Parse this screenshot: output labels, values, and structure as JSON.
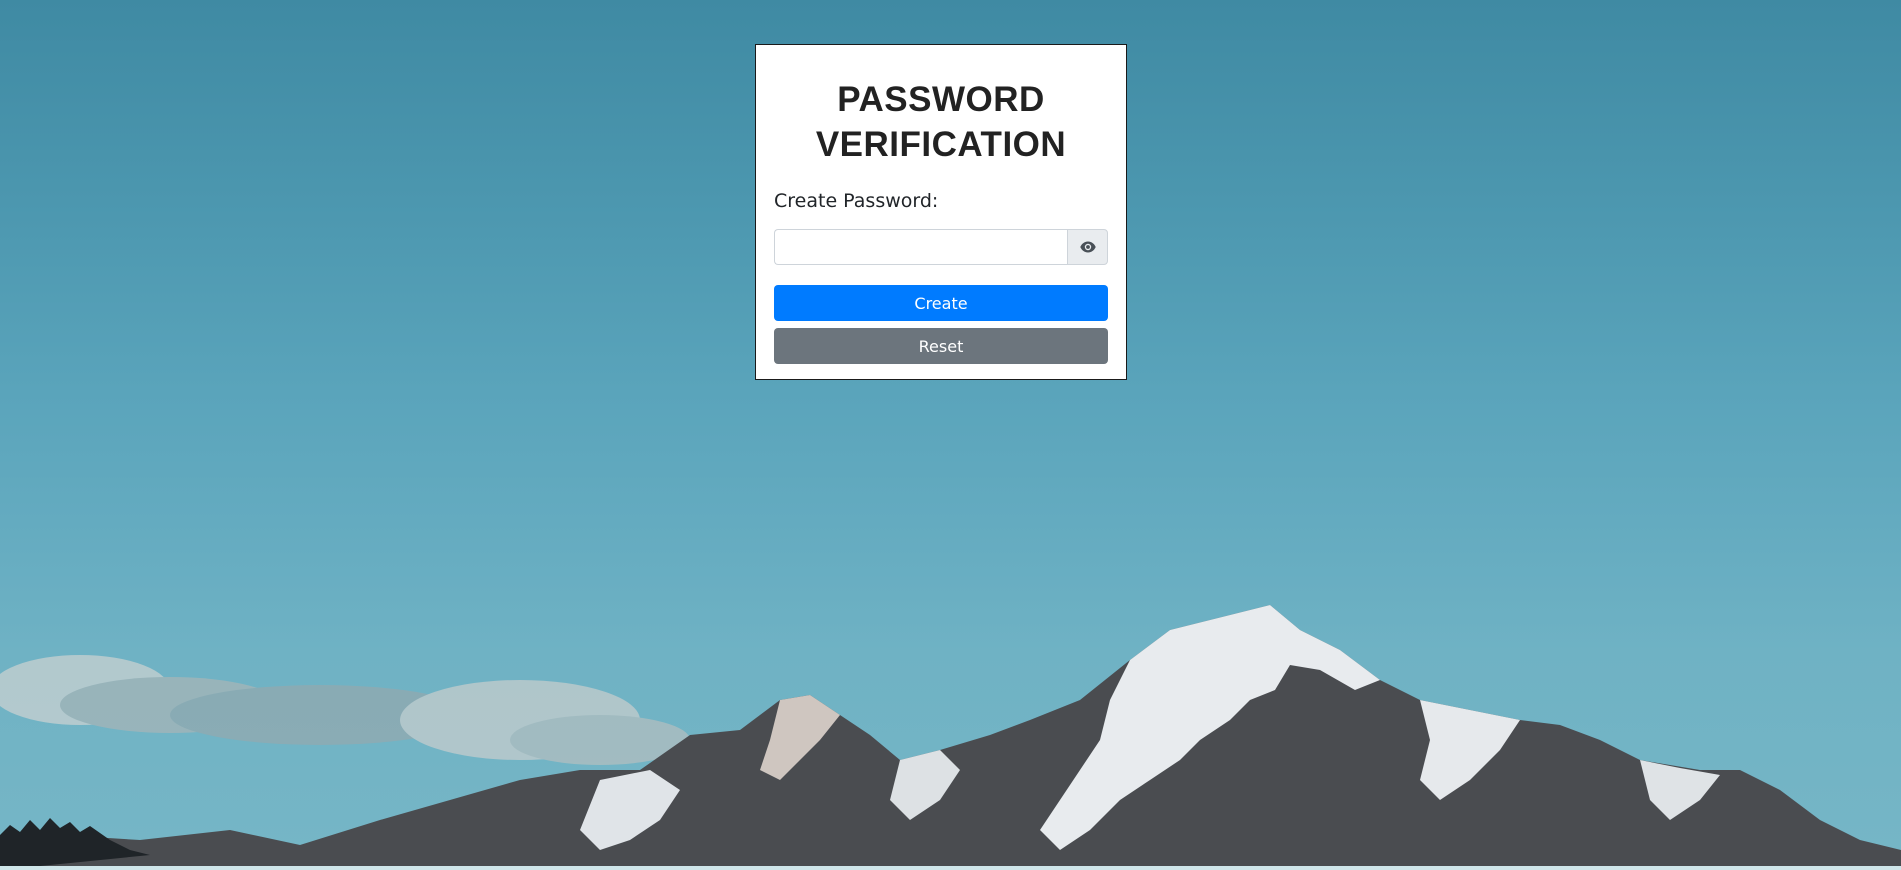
{
  "page": {
    "title_line1": "PASSWORD",
    "title_line2": "VERIFICATION"
  },
  "form": {
    "label": "Create Password:",
    "password_value": "",
    "password_placeholder": "",
    "toggle_icon": "eye-icon",
    "create_label": "Create",
    "reset_label": "Reset"
  },
  "colors": {
    "primary": "#007bff",
    "secondary": "#6c757d",
    "card_bg": "#ffffff",
    "sky": "#4d98b0"
  }
}
